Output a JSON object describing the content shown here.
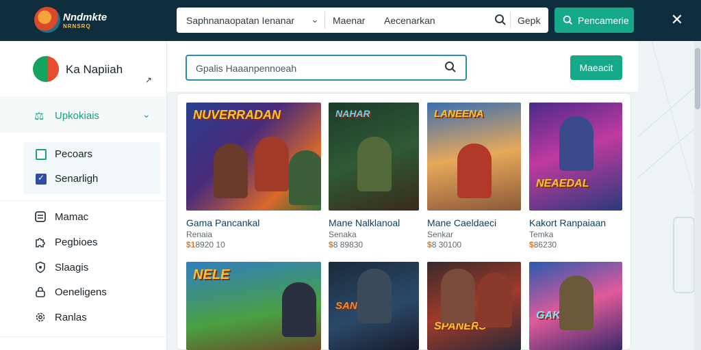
{
  "app": {
    "logo_text": "Nndmkte",
    "logo_sub": "NRNSRQ"
  },
  "search": {
    "category": "Saphnanaopatan Ienanar",
    "field_a": "Maenar",
    "field_b": "Aecenarkan",
    "go_label": "Gepk",
    "button_label": "Pencamerie"
  },
  "profile": {
    "name": "Ka Napiiah"
  },
  "sidebar": {
    "section_label": "Upkokiais",
    "filters": [
      {
        "label": "Pecoars",
        "checked": false
      },
      {
        "label": "Senarligh",
        "checked": true
      }
    ],
    "nav": [
      {
        "label": "Mamac",
        "icon": "message-icon"
      },
      {
        "label": "Pegbioes",
        "icon": "puzzle-icon"
      },
      {
        "label": "Slaagis",
        "icon": "shield-icon"
      },
      {
        "label": "Oeneligens",
        "icon": "lock-icon"
      },
      {
        "label": "Ranlas",
        "icon": "gear-icon"
      }
    ]
  },
  "main": {
    "search_placeholder": "Gpalis Haaanpennoeah",
    "button_label": "Maeacit"
  },
  "cards": [
    {
      "title": "Gama Pancankal",
      "subtitle": "Renaia",
      "price_a": "$1",
      "price_b": "8920 10",
      "art_text": "NUVERRADAN"
    },
    {
      "title": "Mane Nalklanoal",
      "subtitle": "Senaka",
      "price_a": "$",
      "price_b": "8 89830",
      "art_text": "NAHAR"
    },
    {
      "title": "Mane Caeldaeci",
      "subtitle": "Senkar",
      "price_a": "$",
      "price_b": "8 30100",
      "art_text": "LANEENA"
    },
    {
      "title": "Kakort Ranpaiaan",
      "subtitle": "Temka",
      "price_a": "$",
      "price_b": "86230",
      "art_text": "NEAEDAL"
    },
    {
      "title": "",
      "subtitle": "",
      "price_a": "",
      "price_b": "",
      "art_text": "NELE"
    },
    {
      "title": "",
      "subtitle": "",
      "price_a": "",
      "price_b": "",
      "art_text": "SANNERS"
    },
    {
      "title": "",
      "subtitle": "",
      "price_a": "",
      "price_b": "",
      "art_text": "SPANERS"
    },
    {
      "title": "",
      "subtitle": "",
      "price_a": "",
      "price_b": "",
      "art_text": "GAKNAN"
    }
  ],
  "colors": {
    "topbar": "#0e2e3e",
    "accent": "#15a98a",
    "link": "#0e3d58"
  }
}
